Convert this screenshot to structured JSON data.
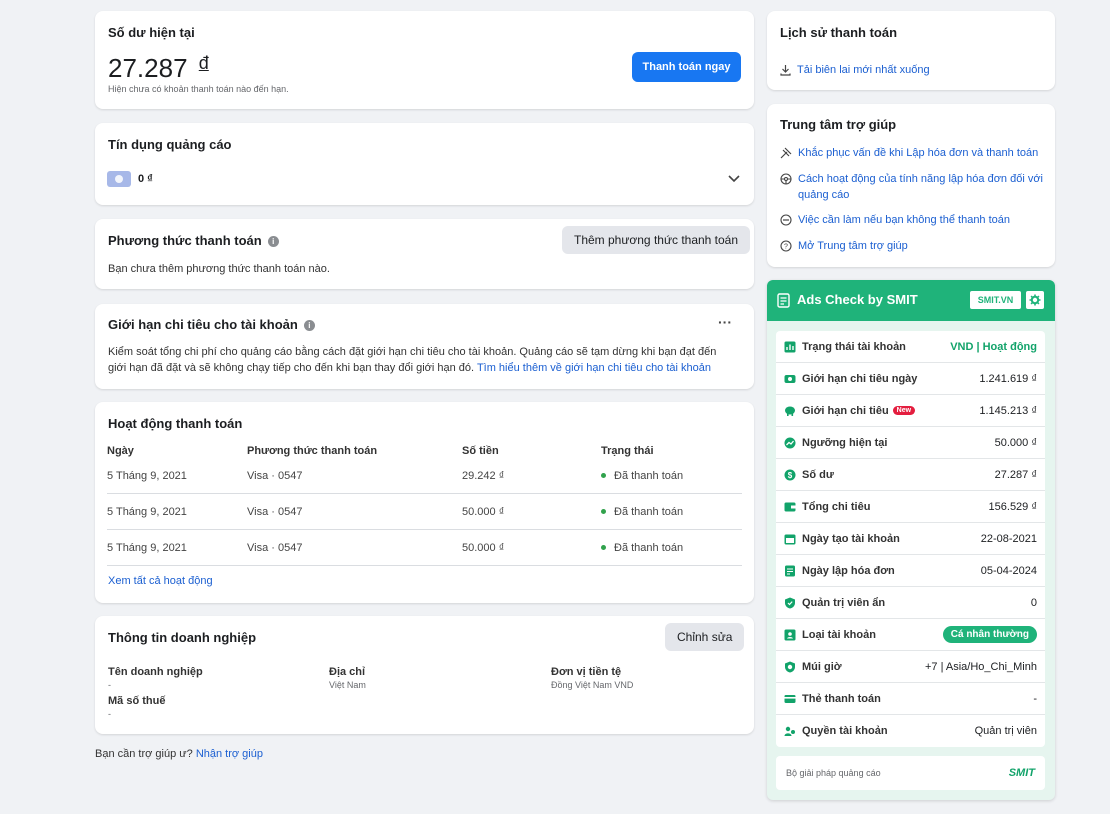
{
  "balance": {
    "title": "Số dư hiện tại",
    "amount": "27.287",
    "currency_symbol": "đ",
    "note": "Hiện chưa có khoản thanh toán nào đến hạn.",
    "pay_button": "Thanh toán ngay"
  },
  "ad_credit": {
    "title": "Tín dụng quảng cáo",
    "value": "0 ₫"
  },
  "payment_method": {
    "title": "Phương thức thanh toán",
    "add_button": "Thêm phương thức thanh toán",
    "empty_text": "Bạn chưa thêm phương thức thanh toán nào."
  },
  "spending_limit": {
    "title": "Giới hạn chi tiêu cho tài khoản",
    "more": "···",
    "text": "Kiểm soát tổng chi phí cho quảng cáo bằng cách đặt giới hạn chi tiêu cho tài khoản. Quảng cáo sẽ tạm dừng khi bạn đạt đến giới hạn đã đặt và sẽ không chạy tiếp cho đến khi bạn thay đổi giới hạn đó.",
    "link": "Tìm hiểu thêm về giới hạn chi tiêu cho tài khoản"
  },
  "activity": {
    "title": "Hoạt động thanh toán",
    "headers": [
      "Ngày",
      "Phương thức thanh toán",
      "Số tiền",
      "Trạng thái"
    ],
    "rows": [
      {
        "date": "5 Tháng 9, 2021",
        "method": "Visa · 0547",
        "amount": "29.242 ₫",
        "status": "Đã thanh toán"
      },
      {
        "date": "5 Tháng 9, 2021",
        "method": "Visa · 0547",
        "amount": "50.000 ₫",
        "status": "Đã thanh toán"
      },
      {
        "date": "5 Tháng 9, 2021",
        "method": "Visa · 0547",
        "amount": "50.000 ₫",
        "status": "Đã thanh toán"
      }
    ],
    "see_all": "Xem tất cả hoạt động"
  },
  "business": {
    "title": "Thông tin doanh nghiệp",
    "edit_button": "Chỉnh sửa",
    "name_label": "Tên doanh nghiệp",
    "name_value": "-",
    "address_label": "Địa chỉ",
    "address_value": "Việt Nam",
    "currency_label": "Đơn vị tiền tệ",
    "currency_value": "Đồng Việt Nam VND",
    "tax_label": "Mã số thuế",
    "tax_value": "-"
  },
  "footer": {
    "question": "Bạn cần trợ giúp ư?",
    "link": "Nhận trợ giúp"
  },
  "history": {
    "title": "Lịch sử thanh toán",
    "download": "Tải biên lai mới nhất xuống"
  },
  "help_center": {
    "title": "Trung tâm trợ giúp",
    "items": [
      "Khắc phục vấn đề khi Lập hóa đơn và thanh toán",
      "Cách hoạt động của tính năng lập hóa đơn đối với quảng cáo",
      "Việc cần làm nếu bạn không thể thanh toán",
      "Mở Trung tâm trợ giúp"
    ]
  },
  "smit": {
    "title": "Ads Check by SMIT",
    "badge": "SMIT.VN",
    "new_tag": "New",
    "rows": [
      {
        "label": "Trạng thái tài khoản",
        "value": "VND | Hoạt động",
        "icon": "chart-icon"
      },
      {
        "label": "Giới hạn chi tiêu ngày",
        "value": "1.241.619 ₫",
        "icon": "money-icon"
      },
      {
        "label": "Giới hạn chi tiêu",
        "value": "1.145.213 ₫",
        "icon": "piggy-icon"
      },
      {
        "label": "Ngưỡng hiện tại",
        "value": "50.000 ₫",
        "icon": "trend-icon"
      },
      {
        "label": "Số dư",
        "value": "27.287 ₫",
        "icon": "dollar-icon"
      },
      {
        "label": "Tổng chi tiêu",
        "value": "156.529 ₫",
        "icon": "wallet-icon"
      },
      {
        "label": "Ngày tạo tài khoản",
        "value": "22-08-2021",
        "icon": "calendar-icon"
      },
      {
        "label": "Ngày lập hóa đơn",
        "value": "05-04-2024",
        "icon": "invoice-icon"
      },
      {
        "label": "Quản trị viên ẩn",
        "value": "0",
        "icon": "shield-icon"
      },
      {
        "label": "Loại tài khoản",
        "value": "Cá nhân thường",
        "icon": "id-card-icon"
      },
      {
        "label": "Múi giờ",
        "value": "+7 | Asia/Ho_Chi_Minh",
        "icon": "shield-clock-icon"
      },
      {
        "label": "Thẻ thanh toán",
        "value": "-",
        "icon": "card-icon"
      },
      {
        "label": "Quyền tài khoản",
        "value": "Quản trị viên",
        "icon": "users-icon"
      }
    ],
    "footer_text": "Bộ giải pháp quảng cáo",
    "footer_logo": "SMIT",
    "colors": {
      "header": "#1fb37a",
      "accent": "#12a36a",
      "panel": "#e6f5ef"
    }
  }
}
